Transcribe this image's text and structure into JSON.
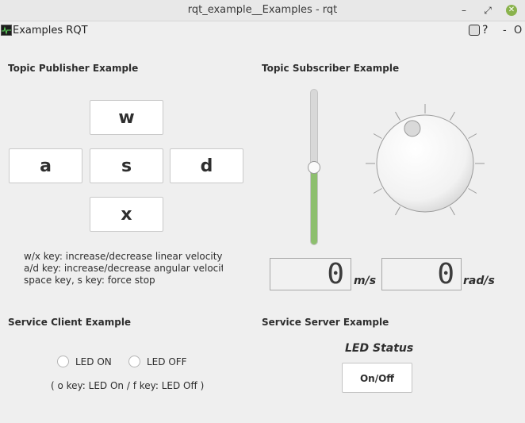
{
  "window": {
    "title": "rqt_example__Examples - rqt",
    "minimize": "–",
    "restore": "⤢",
    "close": "✕"
  },
  "plugin": {
    "title": "Examples RQT",
    "help": "?",
    "minus": "-",
    "close": "O"
  },
  "publisher": {
    "title": "Topic Publisher Example",
    "keys": {
      "w": "w",
      "a": "a",
      "s": "s",
      "d": "d",
      "x": "x"
    },
    "help": [
      "w/x key: increase/decrease linear velocity",
      "a/d key: increase/decrease angular velocity",
      "space key, s key: force stop"
    ]
  },
  "subscriber": {
    "title": "Topic Subscriber Example",
    "linear_slider_level": 0.5,
    "angular_dial_level": 0.5,
    "linear_value": "0",
    "linear_unit": "m/s",
    "angular_value": "0",
    "angular_unit": "rad/s",
    "accent_color": "#8dbf6e"
  },
  "service_client": {
    "title": "Service Client Example",
    "led_on_label": "LED ON",
    "led_off_label": "LED OFF",
    "hint": "( o key: LED On / f key: LED Off )"
  },
  "service_server": {
    "title": "Service Server Example",
    "status_label": "LED Status",
    "button_label": "On/Off"
  },
  "icons": {
    "plugin": "monitor-graph-icon",
    "reload": "reload-icon",
    "close": "close-icon"
  }
}
